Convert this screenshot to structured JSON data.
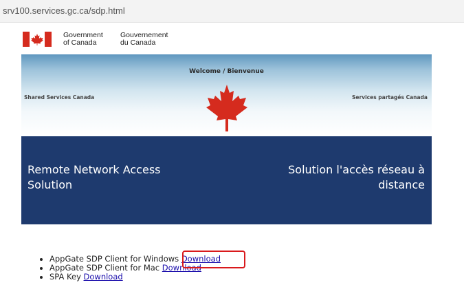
{
  "browser": {
    "url": "srv100.services.gc.ca/sdp.html"
  },
  "gc_signature": {
    "en_line1": "Government",
    "en_line2": "of Canada",
    "fr_line1": "Gouvernement",
    "fr_line2": "du Canada"
  },
  "banner": {
    "welcome": "Welcome / Bienvenue",
    "left_label": "Shared Services Canada",
    "right_label": "Services partagés Canada"
  },
  "hero": {
    "title_en": "Remote Network Access Solution",
    "title_fr": "Solution l'accès réseau à distance",
    "bg_color": "#1e3a6e"
  },
  "downloads": [
    {
      "label": "AppGate SDP Client for Windows ",
      "link": "Download"
    },
    {
      "label": "AppGate SDP Client for Mac ",
      "link": "Download"
    },
    {
      "label": "SPA Key ",
      "link": "Download"
    }
  ],
  "highlight_color": "#d9191c"
}
